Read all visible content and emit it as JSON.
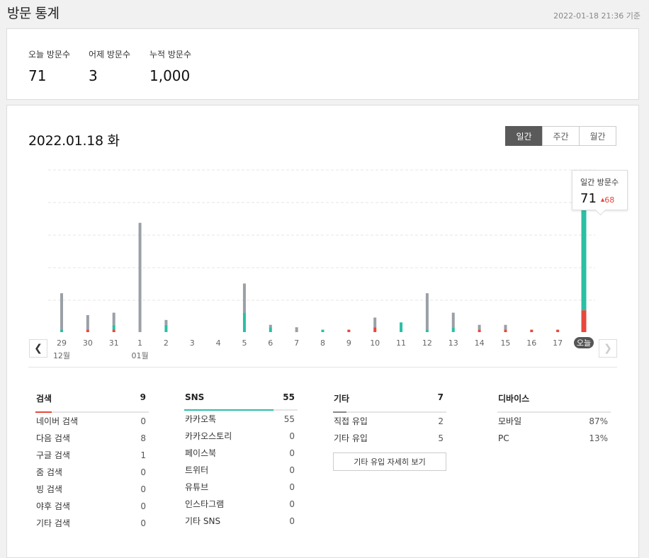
{
  "header": {
    "title": "방문 통계",
    "as_of": "2022-01-18 21:36 기준"
  },
  "summary": [
    {
      "label": "오늘 방문수",
      "value": "71"
    },
    {
      "label": "어제 방문수",
      "value": "3"
    },
    {
      "label": "누적 방문수",
      "value": "1,000"
    }
  ],
  "main": {
    "date": "2022.01.18 화",
    "tabs": [
      {
        "label": "일간"
      },
      {
        "label": "주간"
      },
      {
        "label": "월간"
      }
    ],
    "tooltip": {
      "label": "일간 방문수",
      "value": "71",
      "diff": "68"
    },
    "nav": {
      "prev_icon": "chevron-left-icon",
      "next_icon": "chevron-right-icon"
    }
  },
  "chart_data": {
    "type": "bar",
    "stacked": true,
    "categories": [
      "29",
      "30",
      "31",
      "1",
      "2",
      "3",
      "4",
      "5",
      "6",
      "7",
      "8",
      "9",
      "10",
      "11",
      "12",
      "13",
      "14",
      "15",
      "16",
      "17",
      "오늘"
    ],
    "month_labels": [
      {
        "index": 0,
        "text": "12월"
      },
      {
        "index": 3,
        "text": "01월"
      }
    ],
    "series": [
      {
        "color": "#e8473b",
        "values": [
          0,
          1,
          1,
          0,
          0,
          0,
          0,
          0,
          0,
          0,
          0,
          1,
          2,
          0,
          0,
          0,
          1,
          1,
          1,
          1,
          9
        ]
      },
      {
        "color": "#2bbfa5",
        "values": [
          1,
          0,
          2,
          0,
          3,
          0,
          0,
          8,
          2,
          0,
          1,
          0,
          0,
          4,
          1,
          2,
          0,
          0,
          0,
          0,
          54
        ]
      },
      {
        "color": "#9aa0a6",
        "values": [
          15,
          6,
          5,
          45,
          2,
          0,
          0,
          12,
          1,
          2,
          0,
          0,
          4,
          0,
          15,
          6,
          2,
          2,
          0,
          0,
          3
        ]
      }
    ],
    "colors": {
      "grid": "#e6e6e6",
      "today_badge": "#555555"
    }
  },
  "sections": [
    {
      "title": "검색",
      "total": "9",
      "accent": "#e8473b",
      "rows": [
        {
          "label": "네이버 검색",
          "value": "0"
        },
        {
          "label": "다음 검색",
          "value": "8"
        },
        {
          "label": "구글 검색",
          "value": "1"
        },
        {
          "label": "줌 검색",
          "value": "0"
        },
        {
          "label": "빙 검색",
          "value": "0"
        },
        {
          "label": "야후 검색",
          "value": "0"
        },
        {
          "label": "기타 검색",
          "value": "0"
        }
      ]
    },
    {
      "title": "SNS",
      "total": "55",
      "accent": "#2bbfa5",
      "rows": [
        {
          "label": "카카오톡",
          "value": "55"
        },
        {
          "label": "카카오스토리",
          "value": "0"
        },
        {
          "label": "페이스북",
          "value": "0"
        },
        {
          "label": "트위터",
          "value": "0"
        },
        {
          "label": "유튜브",
          "value": "0"
        },
        {
          "label": "인스타그램",
          "value": "0"
        },
        {
          "label": "기타 SNS",
          "value": "0"
        }
      ]
    },
    {
      "title": "기타",
      "total": "7",
      "accent": "#888888",
      "rows": [
        {
          "label": "직접 유입",
          "value": "2"
        },
        {
          "label": "기타 유입",
          "value": "5"
        }
      ],
      "button": "기타 유입 자세히 보기"
    },
    {
      "title": "디바이스",
      "rows": [
        {
          "label": "모바일",
          "value": "87%"
        },
        {
          "label": "PC",
          "value": "13%"
        }
      ]
    }
  ]
}
